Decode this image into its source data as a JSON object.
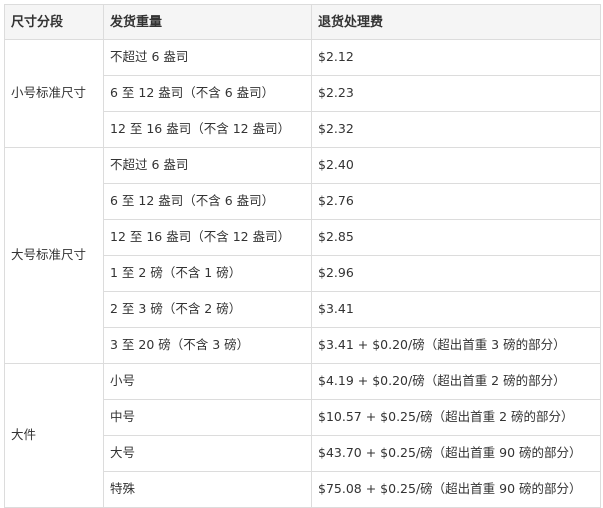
{
  "table": {
    "headers": [
      "尺寸分段",
      "发货重量",
      "退货处理费"
    ],
    "groups": [
      {
        "tier": "小号标准尺寸",
        "rows": [
          {
            "weight": "不超过 6 盎司",
            "fee": "$2.12"
          },
          {
            "weight": "6 至 12 盎司（不含 6 盎司）",
            "fee": "$2.23"
          },
          {
            "weight": "12 至 16 盎司（不含 12 盎司）",
            "fee": "$2.32"
          }
        ]
      },
      {
        "tier": "大号标准尺寸",
        "rows": [
          {
            "weight": "不超过 6 盎司",
            "fee": "$2.40"
          },
          {
            "weight": "6 至 12 盎司（不含 6 盎司）",
            "fee": "$2.76"
          },
          {
            "weight": "12 至 16 盎司（不含 12 盎司）",
            "fee": "$2.85"
          },
          {
            "weight": "1 至 2 磅（不含 1 磅）",
            "fee": "$2.96"
          },
          {
            "weight": "2 至 3 磅（不含 2 磅）",
            "fee": "$3.41"
          },
          {
            "weight": "3 至 20 磅（不含 3 磅）",
            "fee": "$3.41 + $0.20/磅（超出首重 3 磅的部分）"
          }
        ]
      },
      {
        "tier": "大件",
        "rows": [
          {
            "weight": "小号",
            "fee": "$4.19 + $0.20/磅（超出首重 2 磅的部分）"
          },
          {
            "weight": "中号",
            "fee": "$10.57 + $0.25/磅（超出首重 2 磅的部分）"
          },
          {
            "weight": "大号",
            "fee": "$43.70 + $0.25/磅（超出首重 90 磅的部分）"
          },
          {
            "weight": "特殊",
            "fee": "$75.08 + $0.25/磅（超出首重 90 磅的部分）"
          }
        ]
      }
    ]
  }
}
